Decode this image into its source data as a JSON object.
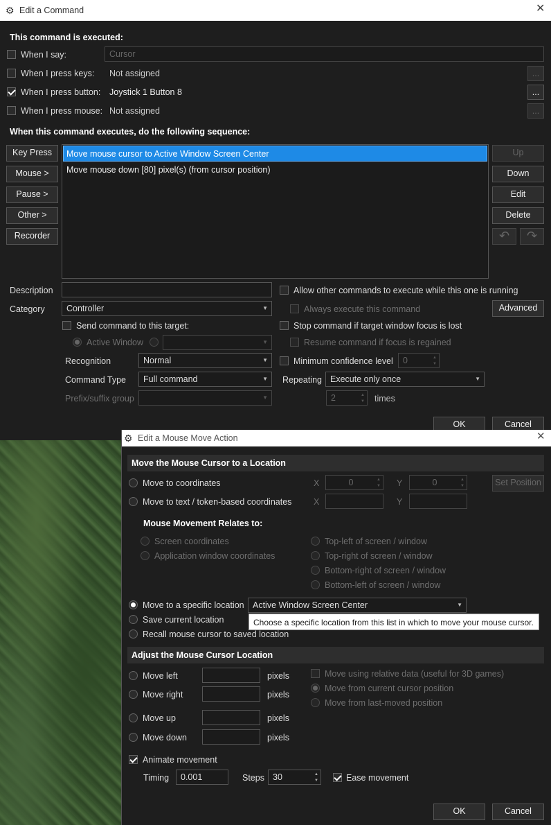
{
  "main": {
    "title": "Edit a Command",
    "executed_header": "This command is executed:",
    "when_say": {
      "label": "When I say:",
      "value": "Cursor",
      "checked": false
    },
    "when_keys": {
      "label": "When I press keys:",
      "value": "Not assigned",
      "checked": false
    },
    "when_button": {
      "label": "When I press button:",
      "value": "Joystick 1 Button 8",
      "checked": true
    },
    "when_mouse": {
      "label": "When I press mouse:",
      "value": "Not assigned",
      "checked": false
    },
    "ellipsis": "...",
    "sequence_header": "When this command executes, do the following sequence:",
    "left_buttons": [
      "Key Press",
      "Mouse >",
      "Pause >",
      "Other >",
      "Recorder"
    ],
    "actions": [
      "Move mouse cursor to Active Window Screen Center",
      "Move mouse down [80] pixel(s) (from cursor position)"
    ],
    "right_buttons": {
      "up": "Up",
      "down": "Down",
      "edit": "Edit",
      "delete": "Delete"
    },
    "description_label": "Description",
    "category_label": "Category",
    "category_value": "Controller",
    "allow_other": "Allow other commands to execute while this one is running",
    "always_execute": "Always execute this command",
    "advanced": "Advanced",
    "send_target": "Send command to this target:",
    "stop_focus": "Stop command if target window focus is lost",
    "active_window": "Active Window",
    "resume_focus": "Resume command if focus is regained",
    "recognition_label": "Recognition",
    "recognition_value": "Normal",
    "min_conf": "Minimum confidence level",
    "min_conf_value": "0",
    "command_type_label": "Command Type",
    "command_type_value": "Full command",
    "repeating_label": "Repeating",
    "repeating_value": "Execute only once",
    "prefix_label": "Prefix/suffix group",
    "times_value": "2",
    "times_label": "times",
    "ok": "OK",
    "cancel": "Cancel"
  },
  "dialog": {
    "title": "Edit a Mouse Move Action",
    "section1": "Move the Mouse Cursor to a Location",
    "move_coords": "Move to coordinates",
    "move_token": "Move to text / token-based coordinates",
    "x_label": "X",
    "y_label": "Y",
    "x_value": "0",
    "y_value": "0",
    "set_position": "Set Position",
    "relates_header": "Mouse Movement Relates to:",
    "screen_coords": "Screen coordinates",
    "app_coords": "Application window coordinates",
    "top_left": "Top-left of screen / window",
    "top_right": "Top-right of screen / window",
    "bottom_right": "Bottom-right of screen / window",
    "bottom_left": "Bottom-left of screen / window",
    "specific_location": "Move to a specific location",
    "specific_value": "Active Window Screen Center",
    "tooltip": "Choose a specific location from this list in which to move your mouse cursor.",
    "save_location": "Save current location",
    "recall_location": "Recall mouse cursor to saved location",
    "section2": "Adjust the Mouse Cursor Location",
    "move_left": "Move left",
    "move_right": "Move right",
    "move_up": "Move up",
    "move_down": "Move down",
    "pixels": "pixels",
    "relative_data": "Move using relative data (useful for 3D games)",
    "from_current": "Move from current cursor position",
    "from_last": "Move from last-moved position",
    "animate": "Animate movement",
    "timing_label": "Timing",
    "timing_value": "0.001",
    "steps_label": "Steps",
    "steps_value": "30",
    "ease": "Ease movement",
    "ok": "OK",
    "cancel": "Cancel"
  }
}
